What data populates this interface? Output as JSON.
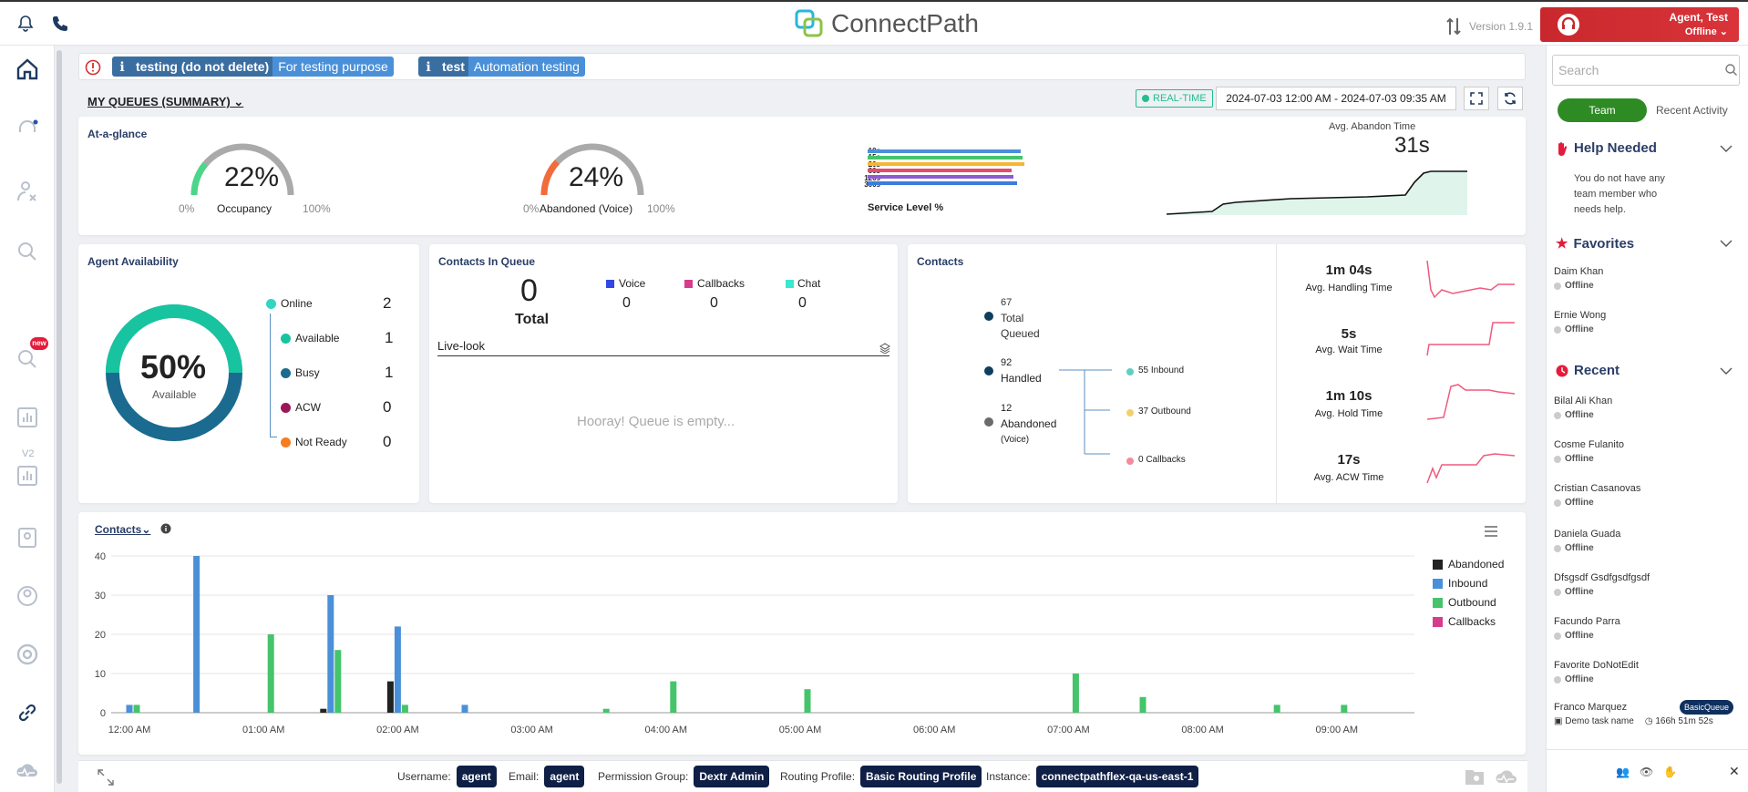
{
  "app": {
    "logo_text": "ConnectPath",
    "version": "Version 1.9.1"
  },
  "agent": {
    "name": "Agent, Test",
    "status": "Offline"
  },
  "notifications": [
    {
      "title": "testing (do not delete)",
      "desc": "For testing purpose"
    },
    {
      "title": "test",
      "desc": "Automation testing"
    }
  ],
  "queues_header": {
    "title": "MY QUEUES (SUMMARY)",
    "realtime": "REAL-TIME",
    "date_range": "2024-07-03 12:00 AM - 2024-07-03 09:35 AM"
  },
  "glance": {
    "title": "At-a-glance",
    "occupancy": {
      "value": "22%",
      "label": "Occupancy",
      "fraction": 0.22,
      "min": "0%",
      "max": "100%"
    },
    "abandoned": {
      "value": "24%",
      "label": "Abandoned (Voice)",
      "fraction": 0.24,
      "min": "0%",
      "max": "100%"
    },
    "service_level": {
      "label": "Service Level %",
      "rows": [
        "10s",
        "15s",
        "20s",
        "60s",
        "120s",
        "300s"
      ]
    },
    "abandon_time": {
      "label": "Avg. Abandon Time",
      "value": "31s"
    }
  },
  "availability": {
    "title": "Agent Availability",
    "center_pct": "50%",
    "center_label": "Available",
    "available_fraction": 0.5,
    "online": {
      "label": "Online",
      "value": "2"
    },
    "items": [
      {
        "label": "Available",
        "value": "1"
      },
      {
        "label": "Busy",
        "value": "1"
      },
      {
        "label": "ACW",
        "value": "0"
      },
      {
        "label": "Not Ready",
        "value": "0"
      }
    ]
  },
  "contacts_queue": {
    "title": "Contacts In Queue",
    "total_value": "0",
    "total_label": "Total",
    "channels": [
      {
        "label": "Voice",
        "value": "0"
      },
      {
        "label": "Callbacks",
        "value": "0"
      },
      {
        "label": "Chat",
        "value": "0"
      }
    ],
    "livelook": "Live-look",
    "empty": "Hooray! Queue is empty..."
  },
  "contacts": {
    "title": "Contacts",
    "queued_value": "67",
    "queued_l1": "Total",
    "queued_l2": "Queued",
    "handled_value": "92",
    "handled_label": "Handled",
    "abandoned_value": "12",
    "abandoned_label": "Abandoned",
    "abandoned_sub": "(Voice)",
    "inbound": "55 Inbound",
    "outbound": "37 Outbound",
    "callbacks": "0 Callbacks",
    "metrics": [
      {
        "value": "1m 04s",
        "label": "Avg. Handling Time"
      },
      {
        "value": "5s",
        "label": "Avg. Wait Time"
      },
      {
        "value": "1m 10s",
        "label": "Avg. Hold Time"
      },
      {
        "value": "17s",
        "label": "Avg. ACW Time"
      }
    ]
  },
  "chart": {
    "title": "Contacts"
  },
  "chart_data": {
    "type": "bar",
    "categories": [
      "12:00 AM",
      "12:15 AM",
      "12:30 AM",
      "12:45 AM",
      "01:00 AM",
      "01:15 AM",
      "01:30 AM",
      "01:45 AM",
      "02:00 AM",
      "02:15 AM",
      "02:30 AM",
      "02:45 AM",
      "03:00 AM",
      "03:15 AM",
      "03:30 AM",
      "03:45 AM",
      "04:00 AM",
      "04:15 AM",
      "04:30 AM",
      "04:45 AM",
      "05:00 AM",
      "05:15 AM",
      "05:30 AM",
      "05:45 AM",
      "06:00 AM",
      "06:15 AM",
      "06:30 AM",
      "06:45 AM",
      "07:00 AM",
      "07:15 AM",
      "07:30 AM",
      "07:45 AM",
      "08:00 AM",
      "08:15 AM",
      "08:30 AM",
      "08:45 AM",
      "09:00 AM",
      "09:15 AM"
    ],
    "tick_labels": [
      "12:00 AM",
      "01:00 AM",
      "02:00 AM",
      "03:00 AM",
      "04:00 AM",
      "05:00 AM",
      "06:00 AM",
      "07:00 AM",
      "08:00 AM",
      "09:00 AM"
    ],
    "series": [
      {
        "name": "Abandoned",
        "color": "#222222",
        "values": [
          0,
          0,
          0,
          0,
          0,
          0,
          1,
          0,
          8,
          0,
          0,
          0,
          0,
          0,
          0,
          0,
          0,
          0,
          0,
          0,
          0,
          0,
          0,
          0,
          0,
          0,
          0,
          0,
          0,
          0,
          0,
          0,
          0,
          0,
          0,
          0,
          0,
          0
        ]
      },
      {
        "name": "Inbound",
        "color": "#4a90d9",
        "values": [
          2,
          0,
          40,
          0,
          0,
          0,
          30,
          0,
          22,
          0,
          2,
          0,
          0,
          0,
          0,
          0,
          0,
          0,
          0,
          0,
          0,
          0,
          0,
          0,
          0,
          0,
          0,
          0,
          0,
          0,
          0,
          0,
          0,
          0,
          0,
          0,
          0,
          0
        ]
      },
      {
        "name": "Outbound",
        "color": "#45c46b",
        "values": [
          2,
          0,
          0,
          0,
          20,
          0,
          16,
          0,
          2,
          0,
          0,
          0,
          0,
          0,
          1,
          0,
          8,
          0,
          0,
          0,
          6,
          0,
          0,
          0,
          0,
          0,
          0,
          0,
          10,
          0,
          4,
          0,
          0,
          0,
          2,
          0,
          2,
          0
        ]
      },
      {
        "name": "Callbacks",
        "color": "#d63c8c",
        "values": [
          0,
          0,
          0,
          0,
          0,
          0,
          0,
          0,
          0,
          0,
          0,
          0,
          0,
          0,
          0,
          0,
          0,
          0,
          0,
          0,
          0,
          0,
          0,
          0,
          0,
          0,
          0,
          0,
          0,
          0,
          0,
          0,
          0,
          0,
          0,
          0,
          0,
          0
        ]
      }
    ],
    "y_ticks": [
      0,
      10,
      20,
      30,
      40
    ],
    "ylim": [
      0,
      44
    ]
  },
  "right_panel": {
    "search_placeholder": "Search",
    "team_tab": "Team",
    "activity_tab": "Recent Activity",
    "help_title": "Help Needed",
    "help_empty": "You do not have any team member who needs help.",
    "favorites_title": "Favorites",
    "favorites": [
      {
        "name": "Daim Khan",
        "status": "Offline"
      },
      {
        "name": "Ernie Wong",
        "status": "Offline"
      }
    ],
    "recent_title": "Recent",
    "recent": [
      {
        "name": "Bilal Ali Khan",
        "status": "Offline"
      },
      {
        "name": "Cosme Fulanito",
        "status": "Offline"
      },
      {
        "name": "Cristian Casanovas",
        "status": "Offline"
      },
      {
        "name": "Daniela Guada",
        "status": "Offline"
      },
      {
        "name": "Dfsgsdf Gsdfgsdfgsdf",
        "status": "Offline"
      },
      {
        "name": "Facundo Parra",
        "status": "Offline"
      },
      {
        "name": "Favorite DoNotEdit",
        "status": "Offline"
      }
    ],
    "last": {
      "name": "Franco Marquez",
      "badge": "BasicQueue",
      "task": "Demo task name",
      "duration": "166h 51m 52s"
    }
  },
  "footer": {
    "username_label": "Username:",
    "username": "agent",
    "email_label": "Email:",
    "email": "agent",
    "perm_label": "Permission Group:",
    "perm": "Dextr Admin",
    "routing_label": "Routing Profile:",
    "routing": "Basic Routing Profile",
    "instance_label": "Instance:",
    "instance": "connectpathflex-qa-us-east-1"
  }
}
